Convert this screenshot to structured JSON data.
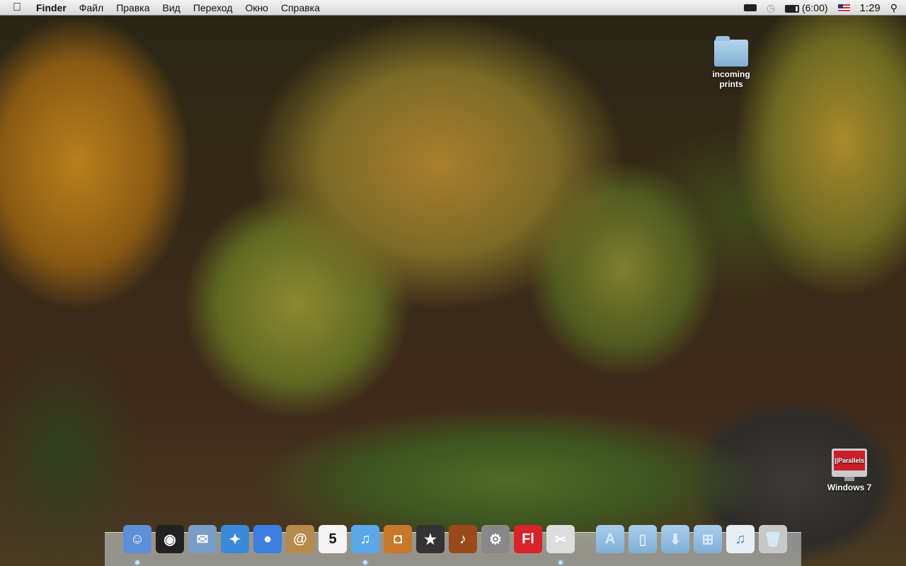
{
  "menubar": {
    "app": "Finder",
    "items": [
      "Файл",
      "Правка",
      "Вид",
      "Переход",
      "Окно",
      "Справка"
    ],
    "battery_time": "(6:00)",
    "clock": "1:29",
    "icons": [
      "apple-icon",
      "window-manager-icon",
      "time-machine-icon",
      "battery-icon",
      "us-flag-icon",
      "spotlight-icon"
    ]
  },
  "desktop": {
    "folder_label": "incoming prints",
    "parallels_label": "Windows 7",
    "parallels_logo": "||Parallels"
  },
  "dock": {
    "items": [
      {
        "name": "finder",
        "glyph": "☺",
        "color": "#5d8fd8"
      },
      {
        "name": "dashboard",
        "glyph": "◉",
        "color": "#222"
      },
      {
        "name": "mail",
        "glyph": "✉",
        "color": "#7a9cc8"
      },
      {
        "name": "safari",
        "glyph": "✦",
        "color": "#3b8ad8"
      },
      {
        "name": "ichat",
        "glyph": "●",
        "color": "#3a7fe0"
      },
      {
        "name": "address-book",
        "glyph": "@",
        "color": "#b58a4a"
      },
      {
        "name": "ical",
        "glyph": "5",
        "color": "#f4f4f4"
      },
      {
        "name": "itunes",
        "glyph": "♫",
        "color": "#5aa8e8"
      },
      {
        "name": "iphoto",
        "glyph": "◘",
        "color": "#c8782a"
      },
      {
        "name": "imovie",
        "glyph": "★",
        "color": "#333"
      },
      {
        "name": "garageband",
        "glyph": "♪",
        "color": "#9a4a1a"
      },
      {
        "name": "system-preferences",
        "glyph": "⚙",
        "color": "#888"
      },
      {
        "name": "flash",
        "glyph": "Fl",
        "color": "#d8232a"
      },
      {
        "name": "script-editor",
        "glyph": "✂",
        "color": "#ddd"
      }
    ],
    "stacks": [
      {
        "name": "applications",
        "glyph": "A"
      },
      {
        "name": "documents",
        "glyph": "▯"
      },
      {
        "name": "downloads",
        "glyph": "⬇"
      },
      {
        "name": "windows-applications",
        "glyph": "⊞"
      },
      {
        "name": "itunes-stack",
        "glyph": "♫"
      },
      {
        "name": "trash",
        "glyph": "🗑"
      }
    ]
  }
}
